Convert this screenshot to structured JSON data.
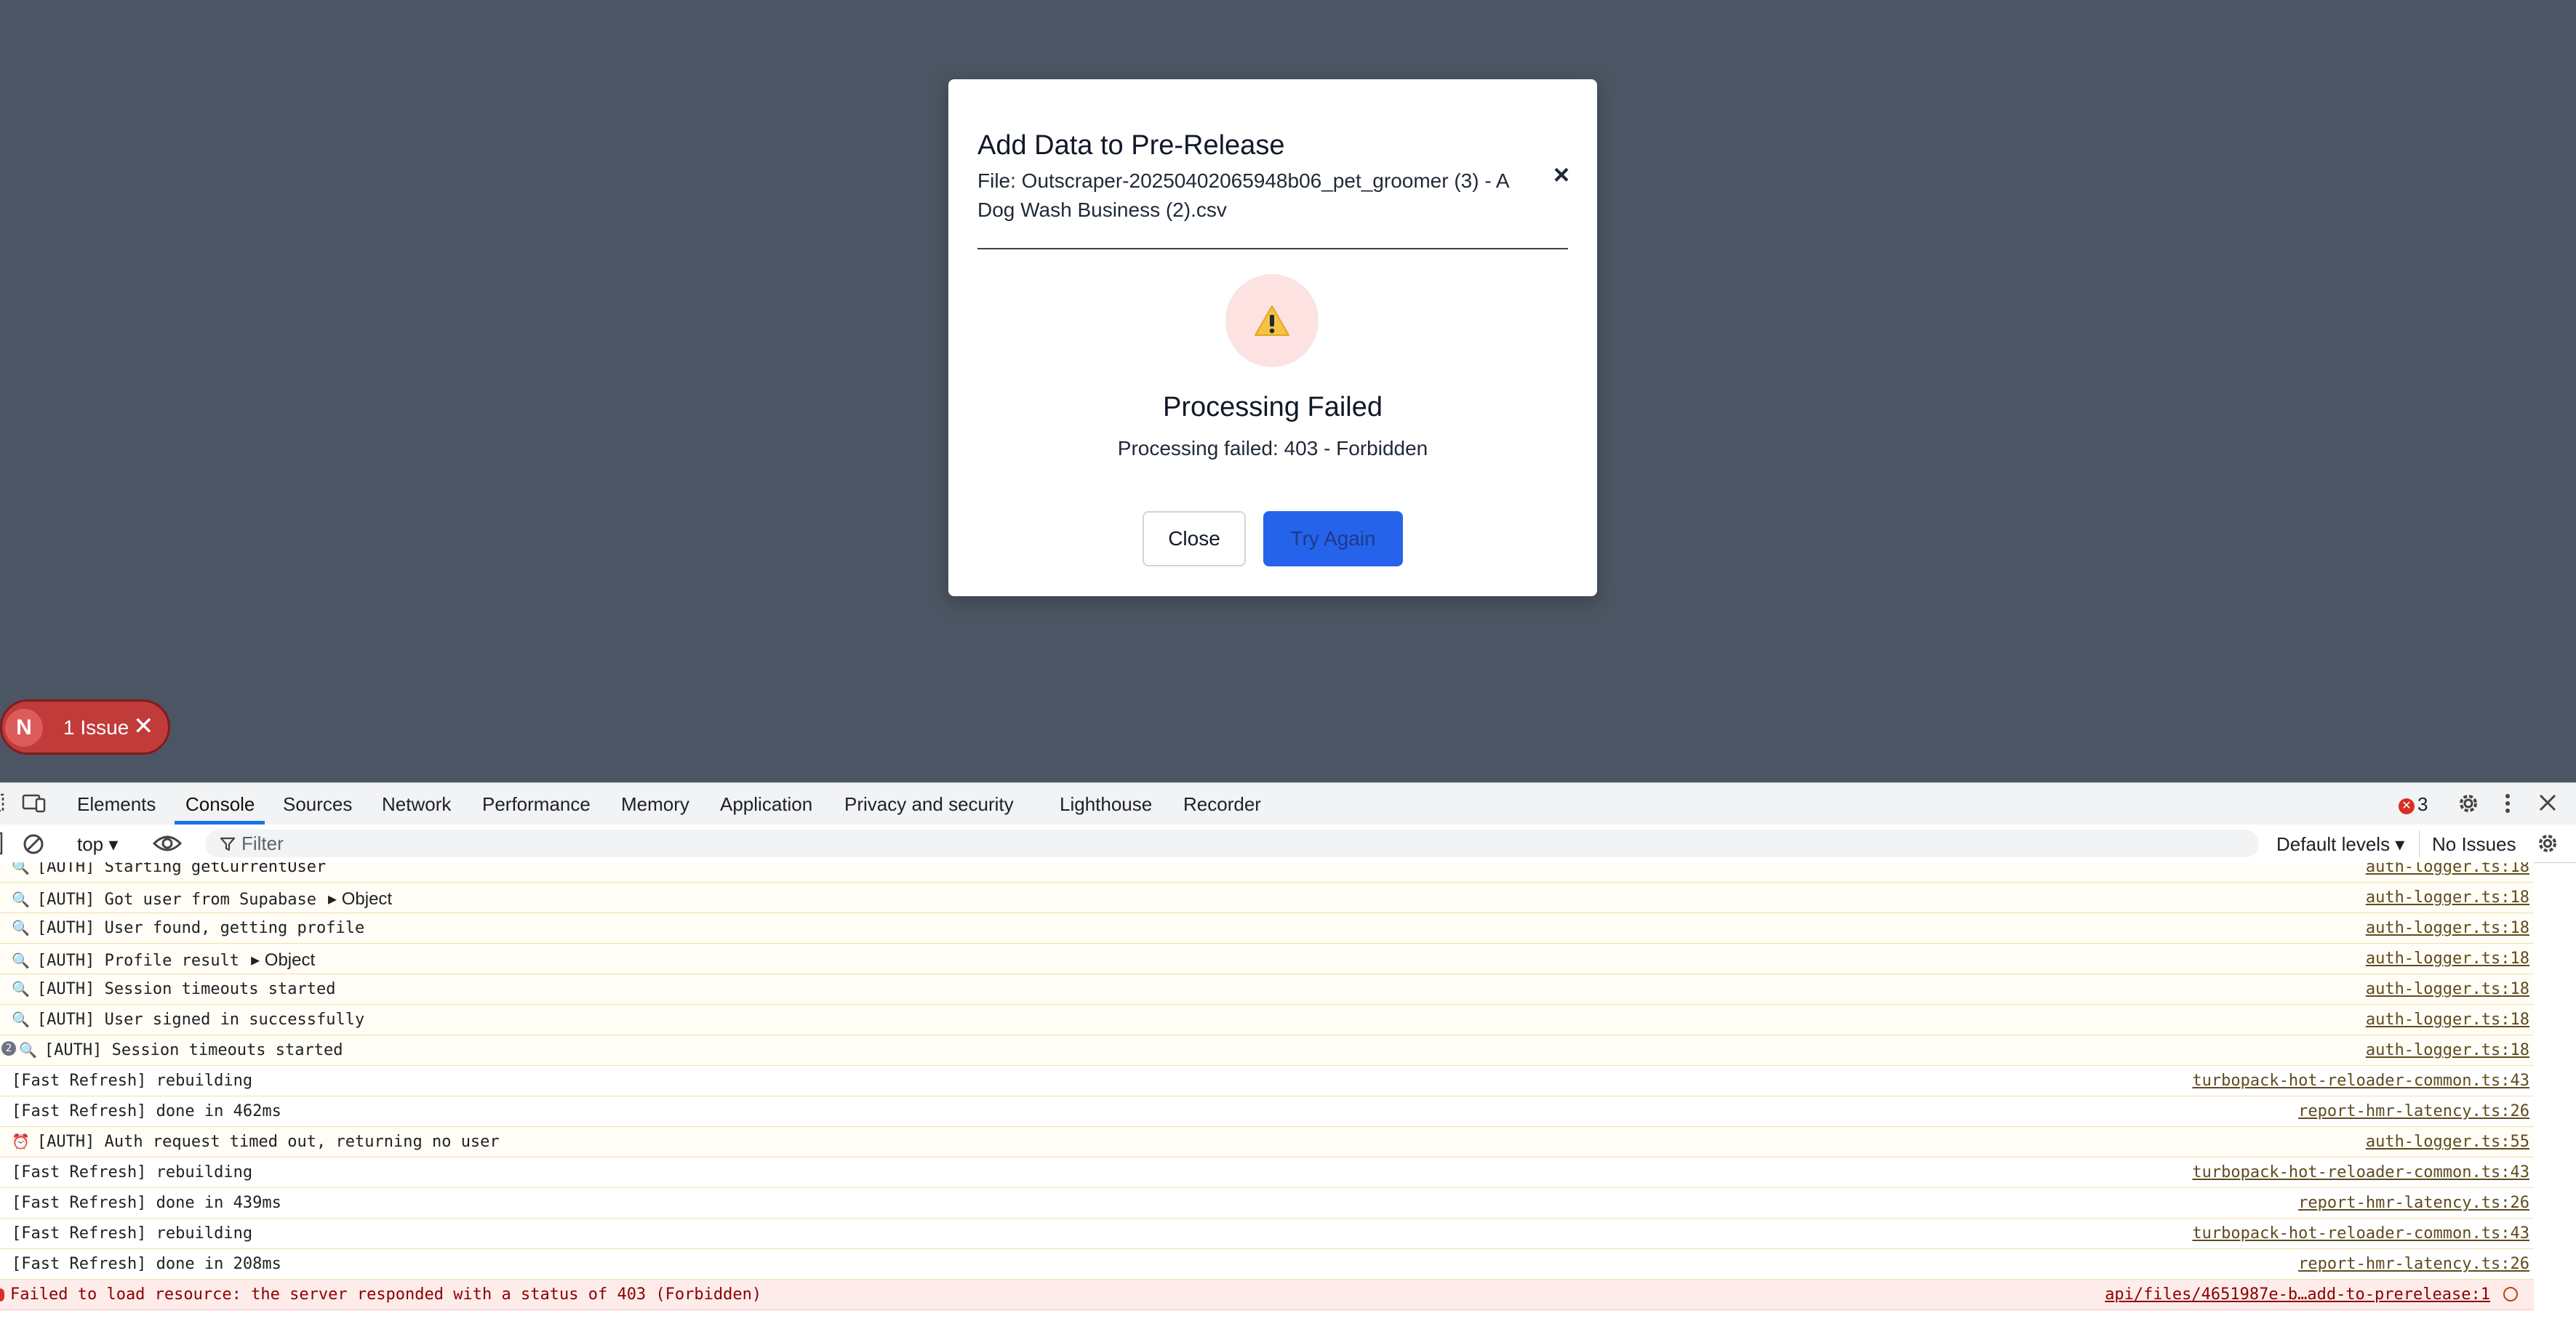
{
  "modal": {
    "title": "Add Data to Pre-Release",
    "file": "File: Outscraper-20250402065948b06_pet_groomer (3) - A Dog Wash Business (2).csv",
    "close_x": "×",
    "status_title": "Processing Failed",
    "status_message": "Processing failed: 403 - Forbidden",
    "close_label": "Close",
    "retry_label": "Try Again"
  },
  "issue_badge": {
    "letter": "N",
    "text": "1 Issue",
    "close": "✕"
  },
  "devtools": {
    "tabs": [
      "Elements",
      "Console",
      "Sources",
      "Network",
      "Performance",
      "Memory",
      "Application",
      "Privacy and security",
      "Lighthouse",
      "Recorder"
    ],
    "active_tab": "Console",
    "error_count": "3",
    "toolbar": {
      "context": "top ▾",
      "filter_placeholder": "Filter",
      "levels": "Default levels ▾",
      "issues": "No Issues"
    },
    "log": [
      {
        "icon": "🔍",
        "msg": "[AUTH] Starting getCurrentUser",
        "src": "auth-logger.ts:18",
        "type": "info",
        "clipped": true
      },
      {
        "icon": "🔍",
        "msg": "[AUTH] Got user from Supabase",
        "obj": "▸ Object",
        "src": "auth-logger.ts:18",
        "type": "info"
      },
      {
        "icon": "🔍",
        "msg": "[AUTH] User found, getting profile",
        "src": "auth-logger.ts:18",
        "type": "info"
      },
      {
        "icon": "🔍",
        "msg": "[AUTH] Profile result",
        "obj": "▸ Object",
        "src": "auth-logger.ts:18",
        "type": "info"
      },
      {
        "icon": "🔍",
        "msg": "[AUTH] Session timeouts started",
        "src": "auth-logger.ts:18",
        "type": "info"
      },
      {
        "icon": "🔍",
        "msg": "[AUTH] User signed in successfully",
        "src": "auth-logger.ts:18",
        "type": "info"
      },
      {
        "icon": "🔍",
        "msg": "[AUTH] Session timeouts started",
        "src": "auth-logger.ts:18",
        "type": "info",
        "repeat": "2"
      },
      {
        "icon": "",
        "msg": "[Fast Refresh] rebuilding",
        "src": "turbopack-hot-reloader-common.ts:43",
        "type": "info"
      },
      {
        "icon": "",
        "msg": "[Fast Refresh] done in 462ms",
        "src": "report-hmr-latency.ts:26",
        "type": "info"
      },
      {
        "icon": "⏰",
        "msg": "[AUTH] Auth request timed out, returning no user",
        "src": "auth-logger.ts:55",
        "type": "info"
      },
      {
        "icon": "",
        "msg": "[Fast Refresh] rebuilding",
        "src": "turbopack-hot-reloader-common.ts:43",
        "type": "info"
      },
      {
        "icon": "",
        "msg": "[Fast Refresh] done in 439ms",
        "src": "report-hmr-latency.ts:26",
        "type": "info"
      },
      {
        "icon": "",
        "msg": "[Fast Refresh] rebuilding",
        "src": "turbopack-hot-reloader-common.ts:43",
        "type": "info"
      },
      {
        "icon": "",
        "msg": "[Fast Refresh] done in 208ms",
        "src": "report-hmr-latency.ts:26",
        "type": "info"
      },
      {
        "icon": "",
        "msg": "Failed to load resource: the server responded with a status of 403 (Forbidden)",
        "src": "api/files/4651987e-b…add-to-prerelease:1",
        "type": "error"
      }
    ]
  },
  "colors": {
    "backdrop": "#4b5563",
    "primary_button": "#2563eb",
    "warning_circle": "#fde2e2",
    "issue_badge": "#c23b3b",
    "console_active_tab": "#1a73e8"
  }
}
